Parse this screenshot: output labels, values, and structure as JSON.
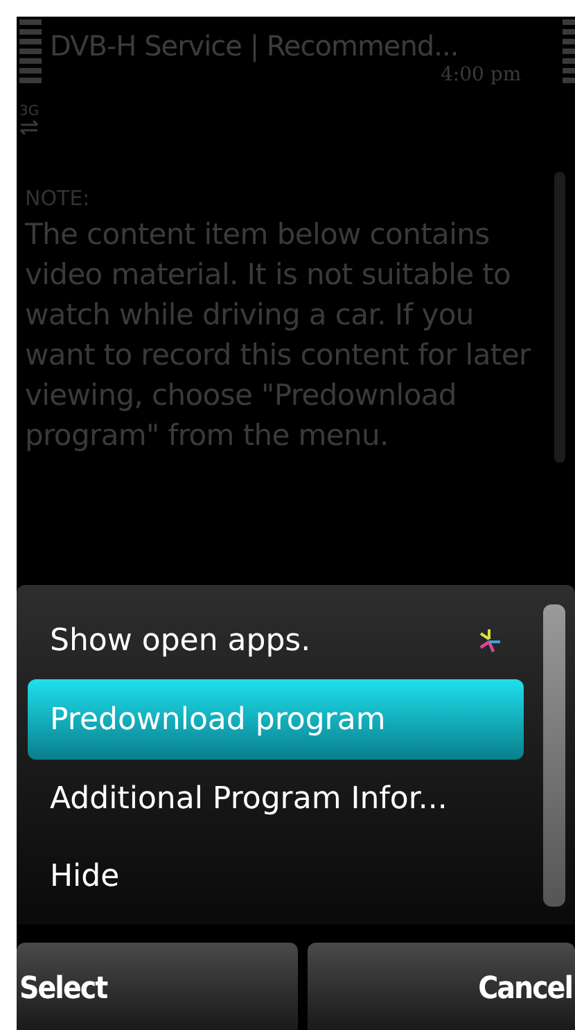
{
  "status_bar": {
    "title": "DVB-H Service | Recommend...",
    "time": "4:00 pm",
    "network": "3G"
  },
  "note": {
    "heading": "NOTE:",
    "text": "The content item below contains video material. It is not suitable to watch while driving a car. If you want to record this content for later viewing, choose \"Predownload program\" from the menu."
  },
  "menu": {
    "items": [
      {
        "label": "Show open apps.",
        "selected": false,
        "kind": "apps"
      },
      {
        "label": "Predownload program",
        "selected": true,
        "kind": "plain"
      },
      {
        "label": "Additional Program Infor...",
        "selected": false,
        "kind": "plain"
      },
      {
        "label": "Hide",
        "selected": false,
        "kind": "plain"
      }
    ]
  },
  "softkeys": [
    "Select",
    "Cancel"
  ]
}
